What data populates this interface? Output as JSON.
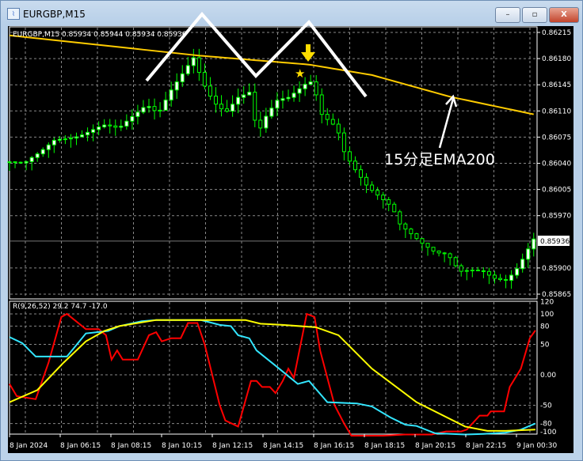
{
  "window": {
    "title": "EURGBP,M15",
    "minimize": "–",
    "restore": "▫",
    "close": "X"
  },
  "chart": {
    "header": "EURGBP,M15  0.85934 0.85944 0.85934 0.85936",
    "price_ticks": [
      "0.86215",
      "0.86180",
      "0.86145",
      "0.86110",
      "0.86075",
      "0.86040",
      "0.86005",
      "0.85970",
      "0.85900",
      "0.85865"
    ],
    "current_price": "0.85936",
    "annotation_text": "15分足EMA200",
    "colors": {
      "bull": "#ffffff",
      "bear": "#000000",
      "wick": "#00ff00",
      "ema": "#ffcc00",
      "red": "#ff0000",
      "cyan": "#33e6ff",
      "yellow": "#ffff00"
    }
  },
  "chart_data": [
    {
      "type": "candlestick",
      "symbol": "EURGBP",
      "timeframe": "M15",
      "ylim": [
        0.85865,
        0.86215
      ],
      "close_anchors": [
        [
          0,
          0.86042
        ],
        [
          2.6,
          0.86037
        ],
        [
          5.4,
          0.86052
        ],
        [
          8.2,
          0.86073
        ],
        [
          12.5,
          0.86079
        ],
        [
          16.8,
          0.86089
        ],
        [
          19.6,
          0.86084
        ],
        [
          21.7,
          0.861
        ],
        [
          24.6,
          0.86121
        ],
        [
          26.7,
          0.8611
        ],
        [
          28.8,
          0.86137
        ],
        [
          31,
          0.86158
        ],
        [
          33.1,
          0.86179
        ],
        [
          34.5,
          0.86147
        ],
        [
          36.6,
          0.86121
        ],
        [
          38.8,
          0.8611
        ],
        [
          40.9,
          0.86131
        ],
        [
          43,
          0.86137
        ],
        [
          44.5,
          0.86079
        ],
        [
          45.9,
          0.861
        ],
        [
          48,
          0.86121
        ],
        [
          50.1,
          0.86126
        ],
        [
          53,
          0.86147
        ],
        [
          54.4,
          0.86153
        ],
        [
          55.8,
          0.8611
        ],
        [
          58.7,
          0.86089
        ],
        [
          60.1,
          0.86052
        ],
        [
          62.2,
          0.86026
        ],
        [
          64.3,
          0.86005
        ],
        [
          66.5,
          0.85994
        ],
        [
          68.6,
          0.85984
        ],
        [
          70,
          0.85962
        ],
        [
          72.2,
          0.85947
        ],
        [
          74.3,
          0.85931
        ],
        [
          76.4,
          0.85918
        ],
        [
          78.6,
          0.85915
        ],
        [
          80.7,
          0.85894
        ],
        [
          82.8,
          0.85899
        ],
        [
          84.9,
          0.85899
        ],
        [
          87.1,
          0.85888
        ],
        [
          89.2,
          0.85883
        ],
        [
          91.3,
          0.85899
        ],
        [
          94,
          0.85936
        ]
      ],
      "ema200": [
        [
          0,
          0.86211
        ],
        [
          34,
          0.86184
        ],
        [
          53.7,
          0.86172
        ],
        [
          65,
          0.86158
        ],
        [
          79,
          0.86129
        ],
        [
          94.3,
          0.86105
        ]
      ]
    },
    {
      "type": "line",
      "title": "R(9,26,52) 29.2 74.7 -17.0",
      "ylim": [
        -100,
        120
      ],
      "y_ticks": [
        "120",
        "100",
        "80",
        "50",
        "0.00",
        "-50",
        "-80",
        "-100"
      ],
      "series": [
        {
          "name": "red",
          "values": [
            [
              0,
              -15
            ],
            [
              1.3,
              -35
            ],
            [
              4.7,
              -40
            ],
            [
              7,
              20
            ],
            [
              9.3,
              95
            ],
            [
              10.3,
              100
            ],
            [
              13.7,
              75
            ],
            [
              16,
              75
            ],
            [
              17.3,
              65
            ],
            [
              18.3,
              25
            ],
            [
              19.3,
              40
            ],
            [
              20.3,
              25
            ],
            [
              23,
              25
            ],
            [
              25,
              65
            ],
            [
              26.3,
              70
            ],
            [
              27.3,
              55
            ],
            [
              29,
              60
            ],
            [
              30.7,
              60
            ],
            [
              32,
              85
            ],
            [
              33.7,
              85
            ],
            [
              35,
              50
            ],
            [
              37.7,
              -50
            ],
            [
              38.7,
              -75
            ],
            [
              41,
              -85
            ],
            [
              43.3,
              -10
            ],
            [
              44.3,
              -10
            ],
            [
              45.3,
              -20
            ],
            [
              46.7,
              -20
            ],
            [
              47.7,
              -30
            ],
            [
              49,
              -10
            ],
            [
              50,
              10
            ],
            [
              51,
              -5
            ],
            [
              53.3,
              100
            ],
            [
              54.7,
              95
            ],
            [
              55.7,
              40
            ],
            [
              58.3,
              -50
            ],
            [
              60,
              -80
            ],
            [
              61.3,
              -100
            ],
            [
              67,
              -100
            ],
            [
              71,
              -98
            ],
            [
              75.7,
              -98
            ],
            [
              78.3,
              -93
            ],
            [
              81,
              -93
            ],
            [
              82,
              -90
            ],
            [
              84.3,
              -67
            ],
            [
              85.7,
              -67
            ],
            [
              86.3,
              -60
            ],
            [
              88.7,
              -60
            ],
            [
              89.7,
              -20
            ],
            [
              91.7,
              10
            ],
            [
              93.3,
              60
            ],
            [
              94.3,
              73
            ]
          ]
        },
        {
          "name": "cyan",
          "values": [
            [
              0,
              62
            ],
            [
              2.3,
              52
            ],
            [
              4.7,
              30
            ],
            [
              10.3,
              30
            ],
            [
              13.7,
              68
            ],
            [
              17.7,
              72
            ],
            [
              19.7,
              80
            ],
            [
              23.7,
              88
            ],
            [
              26.3,
              90
            ],
            [
              34.3,
              90
            ],
            [
              37.7,
              82
            ],
            [
              39.7,
              80
            ],
            [
              41,
              65
            ],
            [
              43,
              60
            ],
            [
              44.3,
              40
            ],
            [
              47.7,
              15
            ],
            [
              51.7,
              -15
            ],
            [
              53.7,
              -10
            ],
            [
              57,
              -45
            ],
            [
              62.3,
              -47
            ],
            [
              65,
              -52
            ],
            [
              68.3,
              -70
            ],
            [
              71,
              -82
            ],
            [
              73,
              -84
            ],
            [
              76.3,
              -96
            ],
            [
              81.7,
              -98
            ],
            [
              85,
              -97
            ],
            [
              89,
              -95
            ],
            [
              91.7,
              -90
            ],
            [
              94.3,
              -80
            ]
          ]
        },
        {
          "name": "yellow",
          "values": [
            [
              0,
              -45
            ],
            [
              5,
              -25
            ],
            [
              9.7,
              20
            ],
            [
              13.7,
              55
            ],
            [
              17,
              72
            ],
            [
              19.7,
              80
            ],
            [
              26.3,
              90
            ],
            [
              42.3,
              90
            ],
            [
              45,
              84
            ],
            [
              49,
              82
            ],
            [
              55,
              78
            ],
            [
              59,
              65
            ],
            [
              65,
              10
            ],
            [
              73,
              -45
            ],
            [
              81.7,
              -85
            ],
            [
              85.7,
              -92
            ],
            [
              89,
              -92
            ],
            [
              94.3,
              -90
            ]
          ]
        }
      ]
    }
  ],
  "time_labels": [
    "8 Jan 2024",
    "8 Jan 06:15",
    "8 Jan 08:15",
    "8 Jan 10:15",
    "8 Jan 12:15",
    "8 Jan 14:15",
    "8 Jan 16:15",
    "8 Jan 18:15",
    "8 Jan 20:15",
    "8 Jan 22:15",
    "9 Jan 00:30"
  ]
}
